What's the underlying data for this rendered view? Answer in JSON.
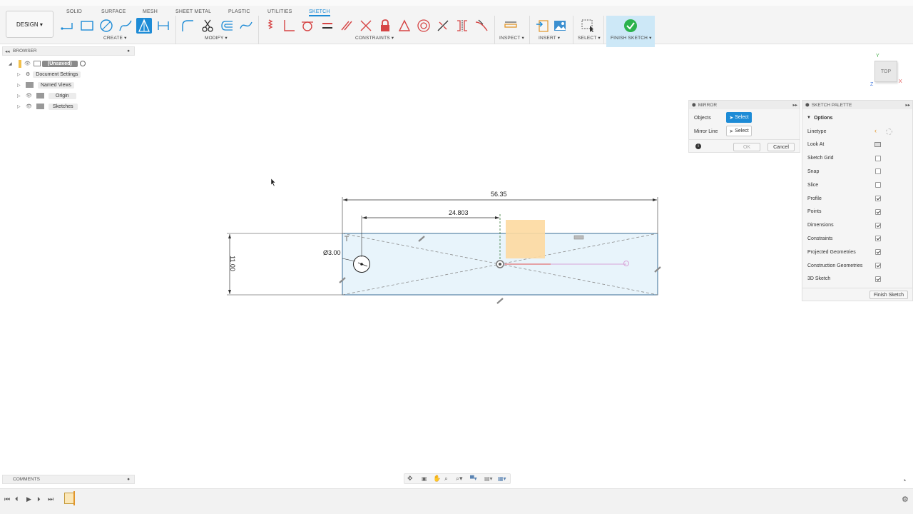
{
  "toolbar": {
    "design_label": "DESIGN ▾",
    "tabs": [
      "SOLID",
      "SURFACE",
      "MESH",
      "SHEET METAL",
      "PLASTIC",
      "UTILITIES",
      "SKETCH"
    ],
    "active_tab": "SKETCH",
    "groups": {
      "create": "CREATE ▾",
      "modify": "MODIFY ▾",
      "constraints": "CONSTRAINTS ▾",
      "inspect": "INSPECT ▾",
      "insert": "INSERT ▾",
      "select": "SELECT ▾",
      "finish": "FINISH SKETCH ▾"
    },
    "accent": "#1d8bd6",
    "finish_color": "#2bb24c"
  },
  "browser": {
    "title": "BROWSER",
    "items": [
      {
        "label": "(Unsaved)"
      },
      {
        "label": "Document Settings"
      },
      {
        "label": "Named Views"
      },
      {
        "label": "Origin"
      },
      {
        "label": "Sketches"
      }
    ]
  },
  "viewcube": {
    "face": "TOP",
    "x_axis": "X",
    "y_axis": "Y",
    "z_axis": "Z"
  },
  "sketch": {
    "dim_total": "56.35",
    "dim_partial": "24.803",
    "dim_height": "11.00",
    "dim_diameter": "Ø3.00",
    "fill_color": "#e8f4fb",
    "profile_color": "#fdd9a0"
  },
  "mirror": {
    "title": "MIRROR",
    "objects_label": "Objects",
    "objects_select": "Select",
    "mirror_line_label": "Mirror Line",
    "mirror_line_select": "Select",
    "ok": "OK",
    "cancel": "Cancel"
  },
  "palette": {
    "title": "SKETCH PALETTE",
    "section": "Options",
    "rows": [
      {
        "label": "Linetype",
        "kind": "linetype"
      },
      {
        "label": "Look At",
        "kind": "lookat"
      },
      {
        "label": "Sketch Grid",
        "kind": "check",
        "checked": false
      },
      {
        "label": "Snap",
        "kind": "check",
        "checked": false
      },
      {
        "label": "Slice",
        "kind": "check",
        "checked": false
      },
      {
        "label": "Profile",
        "kind": "check",
        "checked": true
      },
      {
        "label": "Points",
        "kind": "check",
        "checked": true
      },
      {
        "label": "Dimensions",
        "kind": "check",
        "checked": true
      },
      {
        "label": "Constraints",
        "kind": "check",
        "checked": true
      },
      {
        "label": "Projected Geometries",
        "kind": "check",
        "checked": true
      },
      {
        "label": "Construction Geometries",
        "kind": "check",
        "checked": true
      },
      {
        "label": "3D Sketch",
        "kind": "check",
        "checked": true
      }
    ],
    "finish_button": "Finish Sketch"
  },
  "comments": {
    "title": "COMMENTS"
  }
}
